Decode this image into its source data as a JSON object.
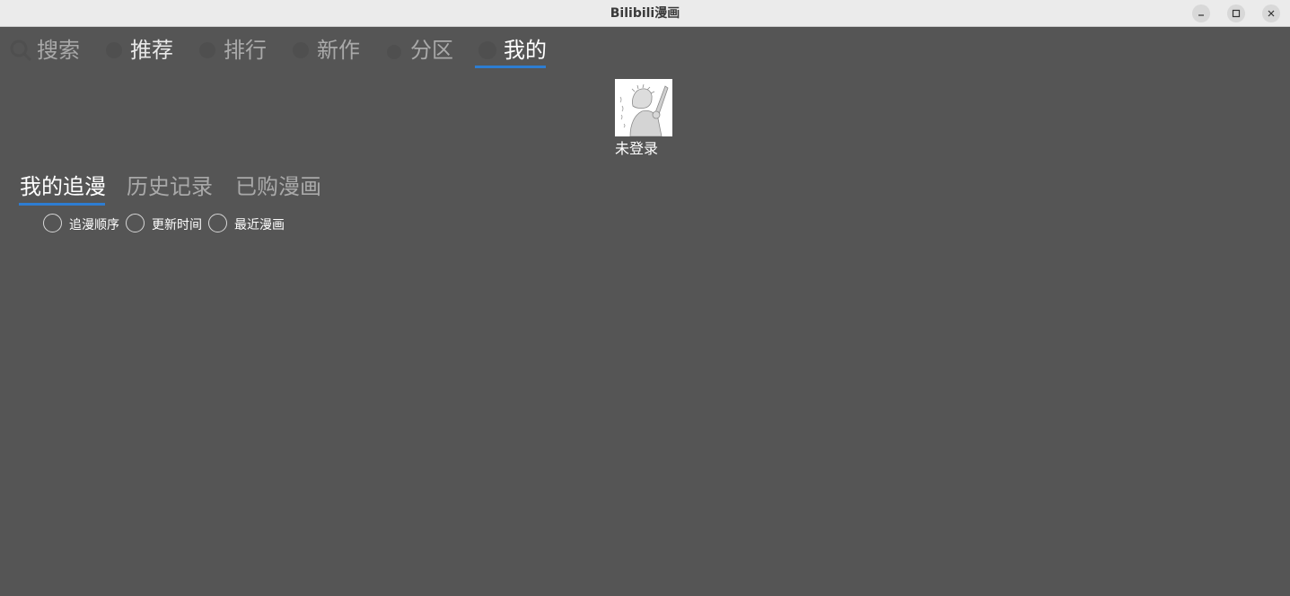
{
  "window": {
    "title": "Bilibili漫画"
  },
  "top_tabs": [
    {
      "label": "搜索",
      "icon": "search-icon"
    },
    {
      "label": "推荐",
      "icon": "recommend-icon"
    },
    {
      "label": "排行",
      "icon": "ranking-icon"
    },
    {
      "label": "新作",
      "icon": "new-icon"
    },
    {
      "label": "分区",
      "icon": "category-icon"
    },
    {
      "label": "我的",
      "icon": "user-icon",
      "active": true
    }
  ],
  "profile": {
    "avatar": "avatar-image",
    "login_status": "未登录"
  },
  "sub_tabs": [
    {
      "label": "我的追漫",
      "active": true
    },
    {
      "label": "历史记录"
    },
    {
      "label": "已购漫画"
    }
  ],
  "sort_options": [
    {
      "label": "追漫顺序",
      "selected": false
    },
    {
      "label": "更新时间",
      "selected": false
    },
    {
      "label": "最近漫画",
      "selected": false
    }
  ],
  "colors": {
    "background": "#555555",
    "accent": "#2d7dd2",
    "titlebar": "#ebebeb"
  }
}
